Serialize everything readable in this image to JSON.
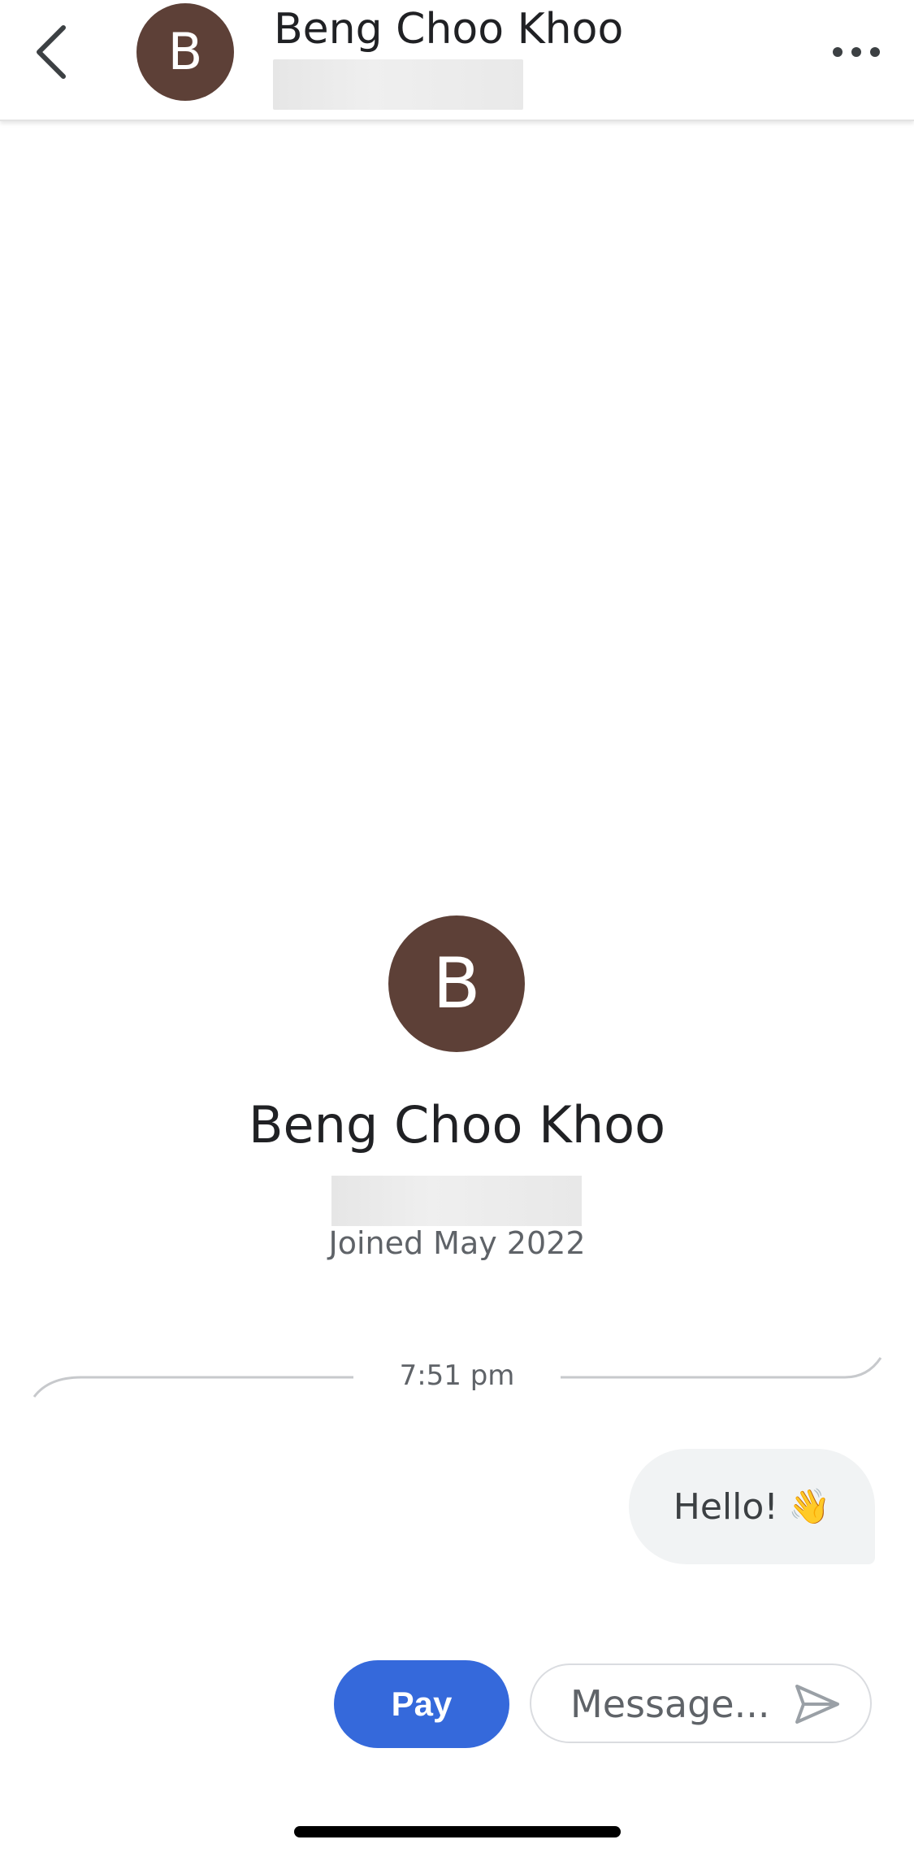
{
  "header": {
    "avatar_initial": "B",
    "contact_name": "Beng Choo Khoo"
  },
  "profile": {
    "avatar_initial": "B",
    "name": "Beng Choo Khoo",
    "joined": "Joined May 2022"
  },
  "conversation": {
    "timestamp": "7:51 pm",
    "messages": [
      {
        "text": "Hello!",
        "emoji": "👋",
        "direction": "sent"
      }
    ]
  },
  "composer": {
    "pay_label": "Pay",
    "message_placeholder": "Message..."
  },
  "colors": {
    "avatar_bg": "#5d4037",
    "pay_button": "#3569db",
    "bubble_bg": "#f1f3f4"
  },
  "icons": {
    "back": "chevron-left-icon",
    "more": "more-horizontal-icon",
    "send": "send-icon"
  }
}
